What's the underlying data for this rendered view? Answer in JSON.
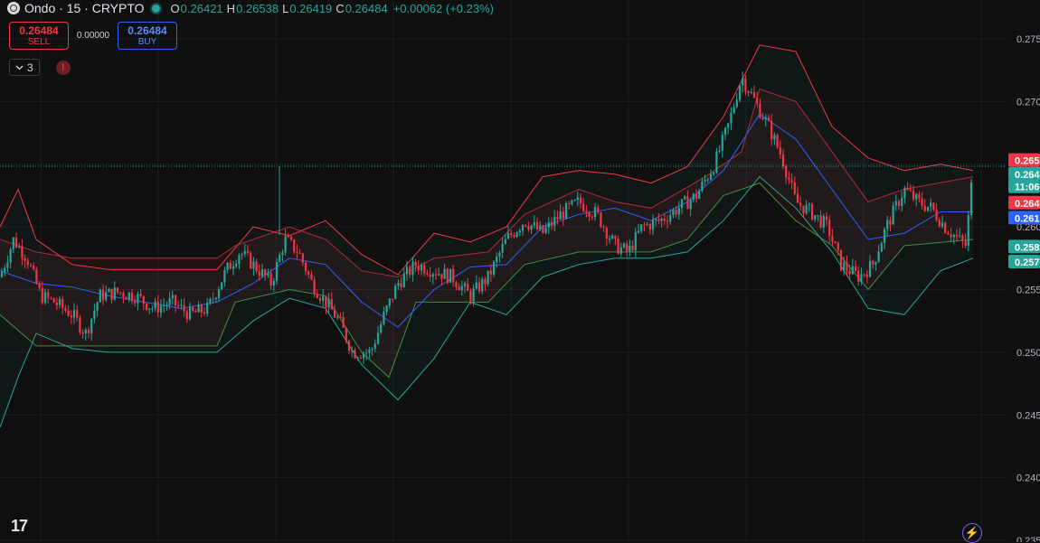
{
  "header": {
    "title": "Ondo · 15 · CRYPTO",
    "ohlc": [
      {
        "key": "O",
        "value": "0.26421"
      },
      {
        "key": "H",
        "value": "0.26538"
      },
      {
        "key": "L",
        "value": "0.26419"
      },
      {
        "key": "C",
        "value": "0.26484"
      }
    ],
    "change": "+0.00062 (+0.23%)"
  },
  "trade": {
    "sell_price": "0.26484",
    "sell_label": "SELL",
    "spread": "0.00000",
    "buy_price": "0.26484",
    "buy_label": "BUY"
  },
  "indicators": {
    "count": "3",
    "alert_glyph": "!"
  },
  "watermark": "17",
  "colors": {
    "up": "#26a69a",
    "down": "#f23645",
    "basis": "#2962ff",
    "upper_band": "#f23645",
    "lower_band": "#26a69a",
    "bg": "#0f0f0f"
  },
  "chart_data": {
    "type": "candlestick",
    "y_ticks": [
      "0.275",
      "0.270",
      "0.265",
      "0.260",
      "0.255",
      "0.250",
      "0.245",
      "0.240",
      "0.235"
    ],
    "ylim": [
      0.235,
      0.277
    ],
    "current_price": 0.26484,
    "price_labels": [
      {
        "text": "0.265",
        "price": 0.2653,
        "color": "#f23645"
      },
      {
        "text": "0.264",
        "price": 0.2642,
        "color": "#26a69a"
      },
      {
        "text": "11:06",
        "price": 0.2632,
        "color": "#26a69a"
      },
      {
        "text": "0.264",
        "price": 0.2619,
        "color": "#f23645"
      },
      {
        "text": "0.261",
        "price": 0.2607,
        "color": "#2962ff"
      },
      {
        "text": "0.258",
        "price": 0.2584,
        "color": "#26a69a"
      },
      {
        "text": "0.257",
        "price": 0.2572,
        "color": "#26a69a"
      }
    ],
    "basis": [
      [
        0,
        0.2565
      ],
      [
        40,
        0.2555
      ],
      [
        80,
        0.2552
      ],
      [
        120,
        0.2545
      ],
      [
        160,
        0.254
      ],
      [
        200,
        0.2535
      ],
      [
        240,
        0.254
      ],
      [
        280,
        0.2555
      ],
      [
        320,
        0.2575
      ],
      [
        360,
        0.257
      ],
      [
        400,
        0.254
      ],
      [
        440,
        0.252
      ],
      [
        480,
        0.255
      ],
      [
        520,
        0.2568
      ],
      [
        560,
        0.257
      ],
      [
        600,
        0.26
      ],
      [
        640,
        0.261
      ],
      [
        680,
        0.2615
      ],
      [
        720,
        0.2605
      ],
      [
        760,
        0.262
      ],
      [
        800,
        0.2645
      ],
      [
        840,
        0.269
      ],
      [
        880,
        0.267
      ],
      [
        920,
        0.263
      ],
      [
        960,
        0.259
      ],
      [
        1000,
        0.2595
      ],
      [
        1040,
        0.2612
      ],
      [
        1076,
        0.2612
      ]
    ],
    "upper_band": [
      [
        0,
        0.26
      ],
      [
        20,
        0.263
      ],
      [
        40,
        0.259
      ],
      [
        80,
        0.257
      ],
      [
        120,
        0.2566
      ],
      [
        160,
        0.2566
      ],
      [
        240,
        0.2566
      ],
      [
        280,
        0.26
      ],
      [
        320,
        0.2593
      ],
      [
        360,
        0.2605
      ],
      [
        400,
        0.2578
      ],
      [
        440,
        0.2562
      ],
      [
        480,
        0.2595
      ],
      [
        520,
        0.2588
      ],
      [
        560,
        0.26
      ],
      [
        600,
        0.264
      ],
      [
        640,
        0.2645
      ],
      [
        680,
        0.2642
      ],
      [
        720,
        0.2635
      ],
      [
        760,
        0.2648
      ],
      [
        800,
        0.2688
      ],
      [
        840,
        0.2745
      ],
      [
        880,
        0.274
      ],
      [
        920,
        0.268
      ],
      [
        960,
        0.2655
      ],
      [
        1000,
        0.2645
      ],
      [
        1040,
        0.265
      ],
      [
        1076,
        0.2645
      ]
    ],
    "lower_band": [
      [
        0,
        0.244
      ],
      [
        20,
        0.248
      ],
      [
        40,
        0.2515
      ],
      [
        80,
        0.2503
      ],
      [
        120,
        0.25
      ],
      [
        160,
        0.25
      ],
      [
        240,
        0.25
      ],
      [
        280,
        0.2525
      ],
      [
        320,
        0.2543
      ],
      [
        360,
        0.2535
      ],
      [
        400,
        0.249
      ],
      [
        440,
        0.2462
      ],
      [
        480,
        0.2495
      ],
      [
        520,
        0.254
      ],
      [
        560,
        0.253
      ],
      [
        600,
        0.256
      ],
      [
        640,
        0.257
      ],
      [
        680,
        0.2575
      ],
      [
        720,
        0.2575
      ],
      [
        760,
        0.258
      ],
      [
        800,
        0.2605
      ],
      [
        840,
        0.264
      ],
      [
        880,
        0.2615
      ],
      [
        920,
        0.258
      ],
      [
        960,
        0.2535
      ],
      [
        1000,
        0.253
      ],
      [
        1040,
        0.2565
      ],
      [
        1076,
        0.2575
      ]
    ],
    "donchian_upper": [
      [
        0,
        0.259
      ],
      [
        40,
        0.258
      ],
      [
        80,
        0.2575
      ],
      [
        240,
        0.2575
      ],
      [
        260,
        0.2585
      ],
      [
        320,
        0.26
      ],
      [
        360,
        0.259
      ],
      [
        400,
        0.2565
      ],
      [
        440,
        0.256
      ],
      [
        480,
        0.2575
      ],
      [
        540,
        0.258
      ],
      [
        580,
        0.261
      ],
      [
        640,
        0.263
      ],
      [
        680,
        0.262
      ],
      [
        720,
        0.2615
      ],
      [
        780,
        0.264
      ],
      [
        820,
        0.266
      ],
      [
        840,
        0.271
      ],
      [
        880,
        0.27
      ],
      [
        920,
        0.266
      ],
      [
        960,
        0.262
      ],
      [
        1000,
        0.263
      ],
      [
        1076,
        0.264
      ]
    ],
    "donchian_lower": [
      [
        0,
        0.253
      ],
      [
        40,
        0.2505
      ],
      [
        240,
        0.2505
      ],
      [
        260,
        0.254
      ],
      [
        320,
        0.255
      ],
      [
        360,
        0.2545
      ],
      [
        400,
        0.25
      ],
      [
        430,
        0.248
      ],
      [
        460,
        0.254
      ],
      [
        540,
        0.254
      ],
      [
        580,
        0.257
      ],
      [
        640,
        0.258
      ],
      [
        720,
        0.258
      ],
      [
        760,
        0.259
      ],
      [
        800,
        0.2625
      ],
      [
        840,
        0.2635
      ],
      [
        880,
        0.2605
      ],
      [
        920,
        0.2585
      ],
      [
        960,
        0.255
      ],
      [
        1000,
        0.2585
      ],
      [
        1076,
        0.259
      ]
    ],
    "price_path": [
      [
        0,
        0.256
      ],
      [
        15,
        0.259
      ],
      [
        30,
        0.2575
      ],
      [
        45,
        0.2545
      ],
      [
        60,
        0.254
      ],
      [
        80,
        0.253
      ],
      [
        95,
        0.2515
      ],
      [
        110,
        0.2545
      ],
      [
        130,
        0.2548
      ],
      [
        150,
        0.2545
      ],
      [
        170,
        0.2535
      ],
      [
        190,
        0.254
      ],
      [
        210,
        0.253
      ],
      [
        230,
        0.2535
      ],
      [
        250,
        0.2565
      ],
      [
        265,
        0.258
      ],
      [
        280,
        0.257
      ],
      [
        300,
        0.2555
      ],
      [
        315,
        0.259
      ],
      [
        330,
        0.258
      ],
      [
        345,
        0.2555
      ],
      [
        360,
        0.254
      ],
      [
        375,
        0.2525
      ],
      [
        390,
        0.25
      ],
      [
        410,
        0.25
      ],
      [
        425,
        0.253
      ],
      [
        440,
        0.2555
      ],
      [
        460,
        0.257
      ],
      [
        480,
        0.2565
      ],
      [
        500,
        0.256
      ],
      [
        520,
        0.2545
      ],
      [
        540,
        0.256
      ],
      [
        560,
        0.259
      ],
      [
        580,
        0.2605
      ],
      [
        600,
        0.2595
      ],
      [
        620,
        0.261
      ],
      [
        640,
        0.262
      ],
      [
        660,
        0.261
      ],
      [
        680,
        0.2585
      ],
      [
        695,
        0.258
      ],
      [
        710,
        0.26
      ],
      [
        730,
        0.2605
      ],
      [
        750,
        0.2615
      ],
      [
        770,
        0.2625
      ],
      [
        790,
        0.265
      ],
      [
        805,
        0.268
      ],
      [
        820,
        0.272
      ],
      [
        835,
        0.27
      ],
      [
        850,
        0.268
      ],
      [
        865,
        0.2655
      ],
      [
        880,
        0.262
      ],
      [
        900,
        0.261
      ],
      [
        915,
        0.26
      ],
      [
        930,
        0.257
      ],
      [
        950,
        0.256
      ],
      [
        965,
        0.257
      ],
      [
        980,
        0.26
      ],
      [
        1000,
        0.263
      ],
      [
        1015,
        0.262
      ],
      [
        1030,
        0.2615
      ],
      [
        1045,
        0.26
      ],
      [
        1060,
        0.259
      ],
      [
        1068,
        0.2585
      ],
      [
        1076,
        0.2648
      ]
    ]
  }
}
